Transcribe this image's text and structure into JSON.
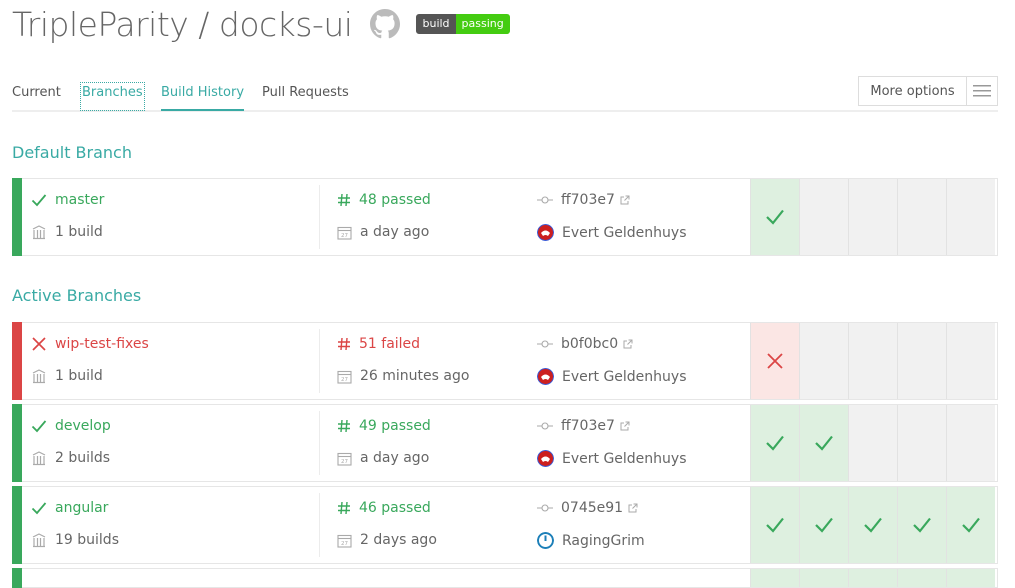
{
  "header": {
    "title": "TripleParity / docks-ui",
    "badge_left": "build",
    "badge_right": "passing"
  },
  "tabs": [
    "Current",
    "Branches",
    "Build History",
    "Pull Requests"
  ],
  "more_options_label": "More options",
  "sections": {
    "default_title": "Default Branch",
    "active_title": "Active Branches"
  },
  "branches": [
    {
      "name": "master",
      "builds": "1 build",
      "status": "48 passed",
      "time": "a day ago",
      "commit": "ff703e7",
      "author": "Evert Geldenhuys"
    },
    {
      "name": "wip-test-fixes",
      "builds": "1 build",
      "status": "51 failed",
      "time": "26 minutes ago",
      "commit": "b0f0bc0",
      "author": "Evert Geldenhuys"
    },
    {
      "name": "develop",
      "builds": "2 builds",
      "status": "49 passed",
      "time": "a day ago",
      "commit": "ff703e7",
      "author": "Evert Geldenhuys"
    },
    {
      "name": "angular",
      "builds": "19 builds",
      "status": "46 passed",
      "time": "2 days ago",
      "commit": "0745e91",
      "author": "RagingGrim"
    }
  ],
  "colors": {
    "accent": "#39aaa4",
    "passed": "#39a85c",
    "failed": "#db4545"
  }
}
